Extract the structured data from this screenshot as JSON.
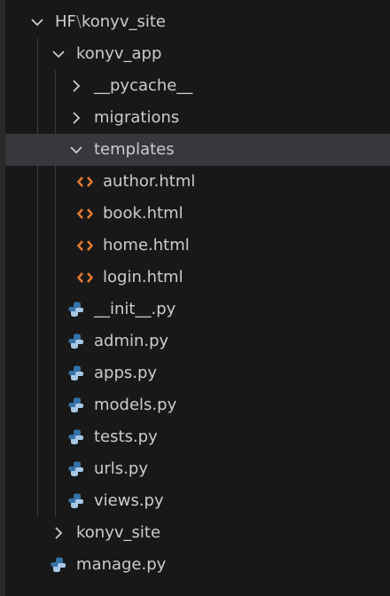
{
  "explorer": {
    "root": {
      "path_start": "HF",
      "separator": "\\",
      "path_end": "konyv_site",
      "icon": "chevron-down-icon"
    },
    "items": [
      {
        "label": "konyv_app",
        "kind": "folder",
        "expanded": true,
        "depth": 1
      },
      {
        "label": "__pycache__",
        "kind": "folder",
        "expanded": false,
        "depth": 2
      },
      {
        "label": "migrations",
        "kind": "folder",
        "expanded": false,
        "depth": 2
      },
      {
        "label": "templates",
        "kind": "folder",
        "expanded": true,
        "depth": 2,
        "selected": true
      },
      {
        "label": "author.html",
        "kind": "html",
        "depth": 3
      },
      {
        "label": "book.html",
        "kind": "html",
        "depth": 3
      },
      {
        "label": "home.html",
        "kind": "html",
        "depth": 3
      },
      {
        "label": "login.html",
        "kind": "html",
        "depth": 3
      },
      {
        "label": "__init__.py",
        "kind": "python",
        "depth": 2
      },
      {
        "label": "admin.py",
        "kind": "python",
        "depth": 2
      },
      {
        "label": "apps.py",
        "kind": "python",
        "depth": 2
      },
      {
        "label": "models.py",
        "kind": "python",
        "depth": 2
      },
      {
        "label": "tests.py",
        "kind": "python",
        "depth": 2
      },
      {
        "label": "urls.py",
        "kind": "python",
        "depth": 2
      },
      {
        "label": "views.py",
        "kind": "python",
        "depth": 2
      },
      {
        "label": "konyv_site",
        "kind": "folder",
        "expanded": false,
        "depth": 1
      },
      {
        "label": "manage.py",
        "kind": "python",
        "depth": 1
      }
    ]
  },
  "colors": {
    "background": "#181818",
    "text": "#cccccc",
    "selected_row": "#37373d",
    "html_icon": "#e37933",
    "python_icon_blue": "#3572a5",
    "python_icon_light": "#a6c8e6"
  }
}
